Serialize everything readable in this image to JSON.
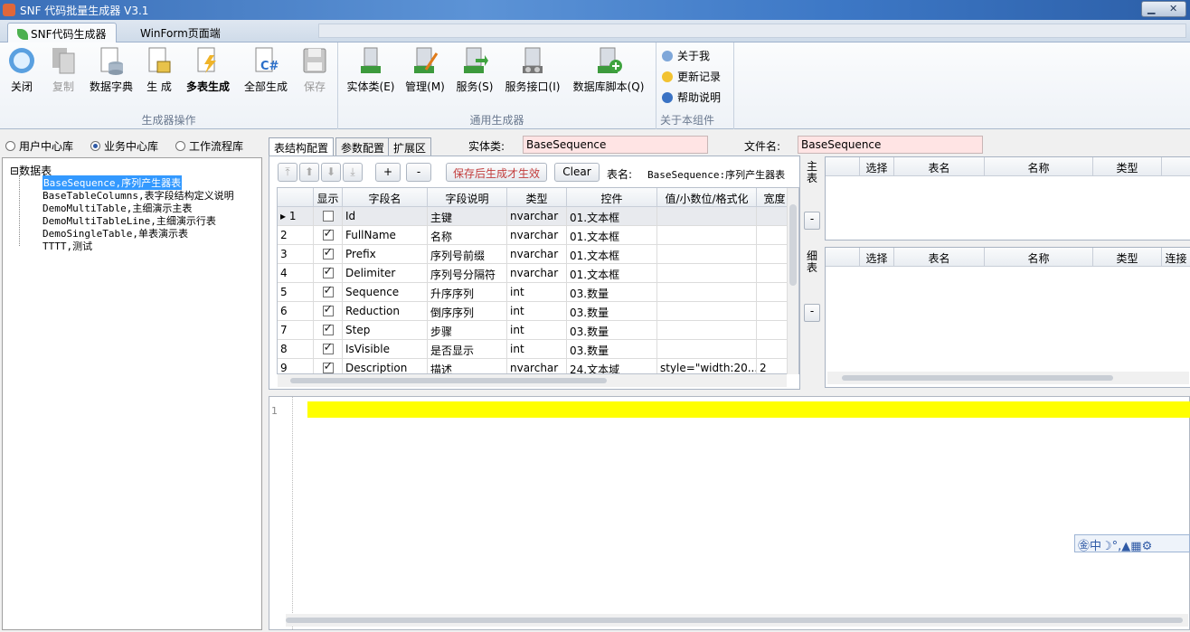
{
  "window": {
    "title": "SNF 代码批量生成器 V3.1"
  },
  "ribbon_tabs": [
    {
      "label": "SNF代码生成器",
      "active": true
    },
    {
      "label": "WinForm页面端",
      "active": false
    }
  ],
  "ribbon": {
    "generator_ops": {
      "label": "生成器操作",
      "buttons": [
        {
          "label": "关闭",
          "icon": "close-orb-icon"
        },
        {
          "label": "复制",
          "icon": "copy-icon",
          "disabled": true
        },
        {
          "label": "数据字典",
          "icon": "data-dictionary-icon"
        },
        {
          "label": "生 成",
          "icon": "generate-icon"
        },
        {
          "label": "多表生成",
          "icon": "multi-table-generate-icon"
        },
        {
          "label": "全部生成",
          "icon": "generate-all-csharp-icon"
        },
        {
          "label": "保存",
          "icon": "save-icon",
          "disabled": true
        }
      ]
    },
    "general_gen": {
      "label": "通用生成器",
      "buttons": [
        {
          "label": "实体类(E)",
          "icon": "entity-class-icon"
        },
        {
          "label": "管理(M)",
          "icon": "manage-icon"
        },
        {
          "label": "服务(S)",
          "icon": "service-icon"
        },
        {
          "label": "服务接口(I)",
          "icon": "service-interface-icon"
        },
        {
          "label": "数据库脚本(Q)",
          "icon": "database-script-icon"
        }
      ]
    },
    "about": {
      "label": "关于本组件",
      "items": [
        {
          "label": "关于我",
          "icon": "about-me-icon"
        },
        {
          "label": "更新记录",
          "icon": "update-log-icon"
        },
        {
          "label": "帮助说明",
          "icon": "help-icon"
        }
      ]
    }
  },
  "left": {
    "radios": [
      {
        "label": "用户中心库",
        "checked": false
      },
      {
        "label": "业务中心库",
        "checked": true
      },
      {
        "label": "工作流程库",
        "checked": false
      }
    ],
    "tree": {
      "root": "数据表",
      "root_toggle": "⊟",
      "nodes": [
        "BaseSequence,序列产生器表",
        "BaseTableColumns,表字段结构定义说明",
        "DemoMultiTable,主细演示主表",
        "DemoMultiTableLine,主细演示行表",
        "DemoSingleTable,单表演示表",
        "TTTT,测试"
      ]
    }
  },
  "config": {
    "tabs": [
      "表结构配置",
      "参数配置",
      "扩展区"
    ],
    "entity_label": "实体类:",
    "entity_value": "BaseSequence",
    "file_label": "文件名:",
    "file_value": "BaseSequence",
    "toolbar": {
      "move_top": "⤒",
      "move_up": "⬆",
      "move_down": "⬇",
      "move_bottom": "⤓",
      "add": "+",
      "remove": "-",
      "save_hint": "保存后生成才生效",
      "clear": "Clear",
      "table_name_label": "表名:",
      "table_name_value": "BaseSequence:序列产生器表"
    },
    "grid": {
      "columns": [
        "",
        "显示",
        "字段名",
        "字段说明",
        "类型",
        "控件",
        "值/小数位/格式化",
        "宽度"
      ],
      "rows": [
        {
          "no": "1",
          "show": false,
          "field": "Id",
          "desc": "主键",
          "type": "nvarchar",
          "control": "01.文本框",
          "format": "",
          "width": "",
          "current": true
        },
        {
          "no": "2",
          "show": true,
          "field": "FullName",
          "desc": "名称",
          "type": "nvarchar",
          "control": "01.文本框",
          "format": "",
          "width": ""
        },
        {
          "no": "3",
          "show": true,
          "field": "Prefix",
          "desc": "序列号前缀",
          "type": "nvarchar",
          "control": "01.文本框",
          "format": "",
          "width": ""
        },
        {
          "no": "4",
          "show": true,
          "field": "Delimiter",
          "desc": "序列号分隔符",
          "type": "nvarchar",
          "control": "01.文本框",
          "format": "",
          "width": ""
        },
        {
          "no": "5",
          "show": true,
          "field": "Sequence",
          "desc": "升序序列",
          "type": "int",
          "control": "03.数量",
          "format": "",
          "width": ""
        },
        {
          "no": "6",
          "show": true,
          "field": "Reduction",
          "desc": "倒序序列",
          "type": "int",
          "control": "03.数量",
          "format": "",
          "width": ""
        },
        {
          "no": "7",
          "show": true,
          "field": "Step",
          "desc": "步骤",
          "type": "int",
          "control": "03.数量",
          "format": "",
          "width": ""
        },
        {
          "no": "8",
          "show": true,
          "field": "IsVisible",
          "desc": "是否显示",
          "type": "int",
          "control": "03.数量",
          "format": "",
          "width": ""
        },
        {
          "no": "9",
          "show": true,
          "field": "Description",
          "desc": "描述",
          "type": "nvarchar",
          "control": "24.文本域",
          "format": "style=\"width:20...",
          "width": "2"
        }
      ]
    }
  },
  "right": {
    "main_label": "主\n表",
    "detail_label": "细\n表",
    "minus": "-",
    "main_columns": [
      "",
      "选择",
      "表名",
      "名称",
      "类型"
    ],
    "detail_columns": [
      "",
      "选择",
      "表名",
      "名称",
      "类型",
      "连接"
    ]
  },
  "editor": {
    "line_number": "1"
  },
  "ime": {
    "text": "㊎中☽°,▲▦⚙"
  }
}
